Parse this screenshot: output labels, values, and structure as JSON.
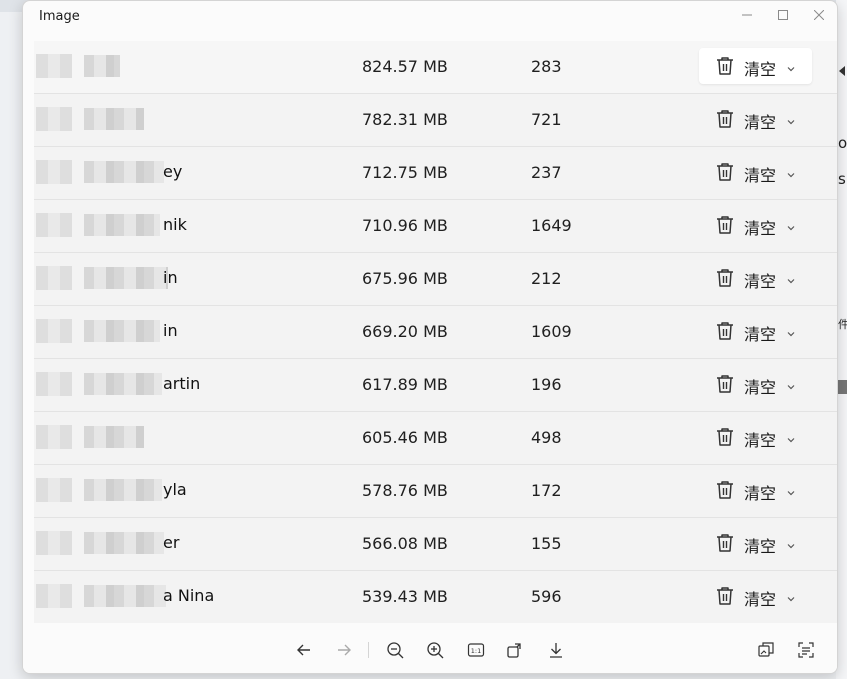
{
  "window": {
    "title": "Image"
  },
  "clear_label": "清空",
  "rows": [
    {
      "name": "",
      "size": "824.57 MB",
      "count": "283",
      "selected": true
    },
    {
      "name": "",
      "size": "782.31 MB",
      "count": "721"
    },
    {
      "name": "ey",
      "size": "712.75 MB",
      "count": "237"
    },
    {
      "name": "nik",
      "size": "710.96 MB",
      "count": "1649"
    },
    {
      "name": "in",
      "size": "675.96 MB",
      "count": "212"
    },
    {
      "name": "in",
      "size": "669.20 MB",
      "count": "1609"
    },
    {
      "name": "artin",
      "size": "617.89 MB",
      "count": "196"
    },
    {
      "name": "",
      "size": "605.46 MB",
      "count": "498"
    },
    {
      "name": "yla",
      "size": "578.76 MB",
      "count": "172"
    },
    {
      "name": "er",
      "size": "566.08 MB",
      "count": "155"
    },
    {
      "name": "a Nina",
      "size": "539.43 MB",
      "count": "596"
    }
  ],
  "toolbar": {
    "icons": [
      "arrow-left-icon",
      "arrow-right-icon",
      "zoom-out-icon",
      "zoom-in-icon",
      "actual-size-icon",
      "rotate-icon",
      "download-icon",
      "copy-image-icon",
      "text-extract-icon"
    ]
  }
}
